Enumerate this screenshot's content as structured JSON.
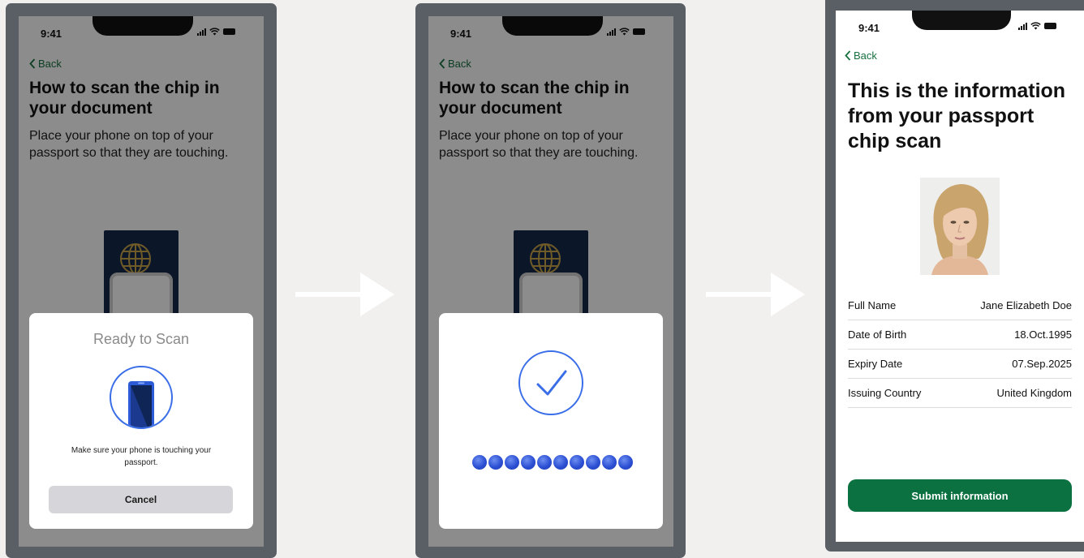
{
  "status_bar": {
    "time": "9:41"
  },
  "screens": {
    "scan": {
      "back": "Back",
      "title": "How to scan the chip in your document",
      "instruction": "Place your phone on top of your passport so that they are touching.",
      "sheet": {
        "title": "Ready to Scan",
        "message": "Make sure your phone is touching your passport.",
        "cancel": "Cancel"
      }
    },
    "success": {
      "back": "Back",
      "title": "How to scan the chip in your document",
      "instruction": "Place your phone on top of your passport so that they are touching.",
      "progress_dots": 10
    },
    "info": {
      "back": "Back",
      "title": "This is the information from your passport chip scan",
      "rows": [
        {
          "label": "Full Name",
          "value": "Jane Elizabeth Doe"
        },
        {
          "label": "Date of Birth",
          "value": "18.Oct.1995"
        },
        {
          "label": "Expiry Date",
          "value": "07.Sep.2025"
        },
        {
          "label": "Issuing Country",
          "value": "United Kingdom"
        }
      ],
      "submit": "Submit information"
    }
  },
  "colors": {
    "accent_green": "#0b7140",
    "link_green": "#18703f",
    "scan_blue": "#3a6ee8",
    "passport_navy": "#15284a",
    "frame_gray": "#5a5f66",
    "background": "#f1f0ee"
  },
  "icons": {
    "back": "chevron-left-icon",
    "scan": "phone-scan-icon",
    "success": "checkmark-circle-icon",
    "arrow": "arrow-right-icon",
    "globe": "globe-icon"
  }
}
